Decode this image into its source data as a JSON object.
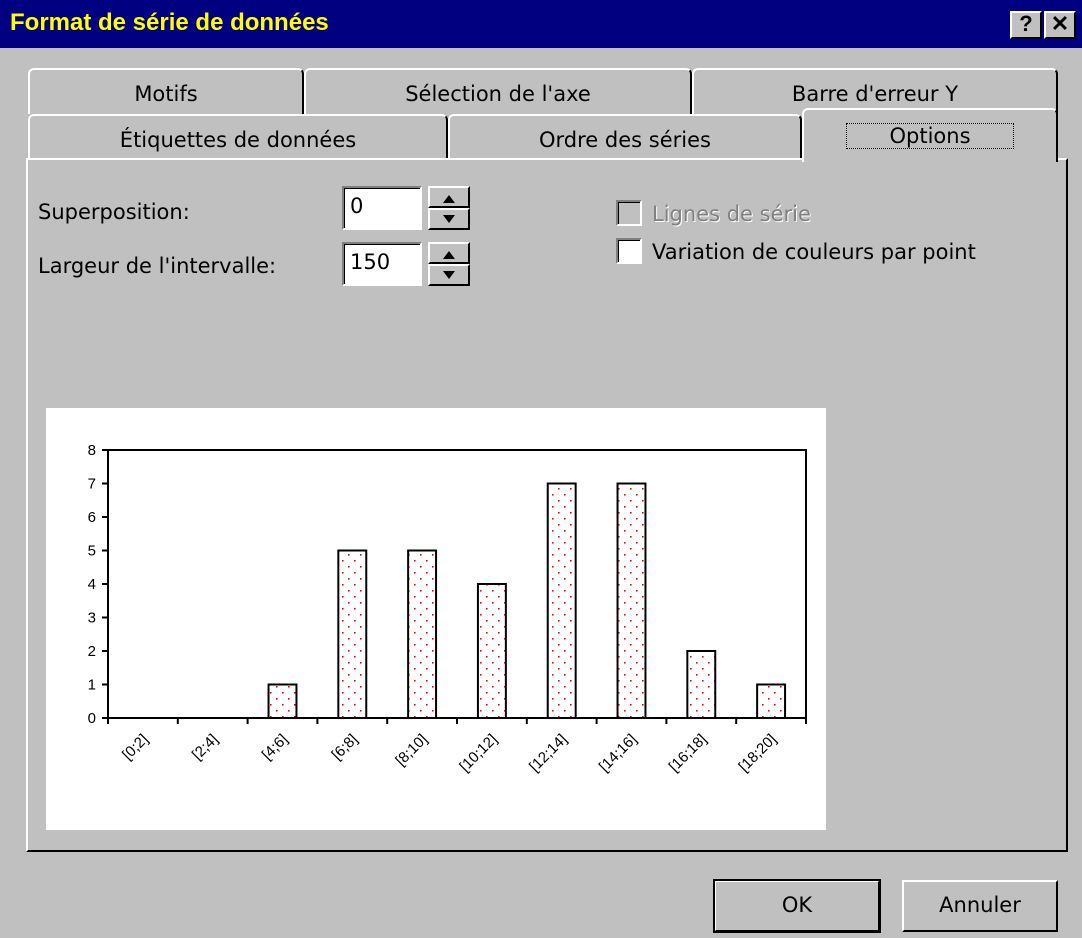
{
  "window": {
    "title": "Format de série de données",
    "help_label": "?",
    "close_label": "✕"
  },
  "tabs_back": [
    {
      "label": "Motifs"
    },
    {
      "label": "Sélection de l'axe"
    },
    {
      "label": "Barre d'erreur Y"
    }
  ],
  "tabs_front": [
    {
      "label": "Étiquettes de données"
    },
    {
      "label": "Ordre des séries"
    },
    {
      "label": "Options"
    }
  ],
  "options": {
    "overlap_label": "Superposition:",
    "overlap_value": "0",
    "gap_label": "Largeur de l'intervalle:",
    "gap_value": "150",
    "series_lines_label": "Lignes de série",
    "vary_colors_label": "Variation de couleurs par point"
  },
  "buttons": {
    "ok": "OK",
    "cancel": "Annuler"
  },
  "colors": {
    "titlebar": "#000080",
    "title_text": "#ffff00",
    "bar_dots": "#ff0000",
    "face": "#c0c0c0"
  },
  "chart_data": {
    "type": "bar",
    "categories": [
      "[0;2]",
      "[2;4]",
      "[4;6]",
      "[6;8]",
      "[8;10]",
      "[10;12]",
      "[12;14]",
      "[14;16]",
      "[16;18]",
      "[18;20]"
    ],
    "values": [
      0,
      0,
      1,
      5,
      5,
      4,
      7,
      7,
      2,
      1
    ],
    "ylim": [
      0,
      8
    ],
    "yticks": [
      0,
      1,
      2,
      3,
      4,
      5,
      6,
      7,
      8
    ],
    "grid": false,
    "legend": "none",
    "fill": "white with red dot pattern"
  }
}
